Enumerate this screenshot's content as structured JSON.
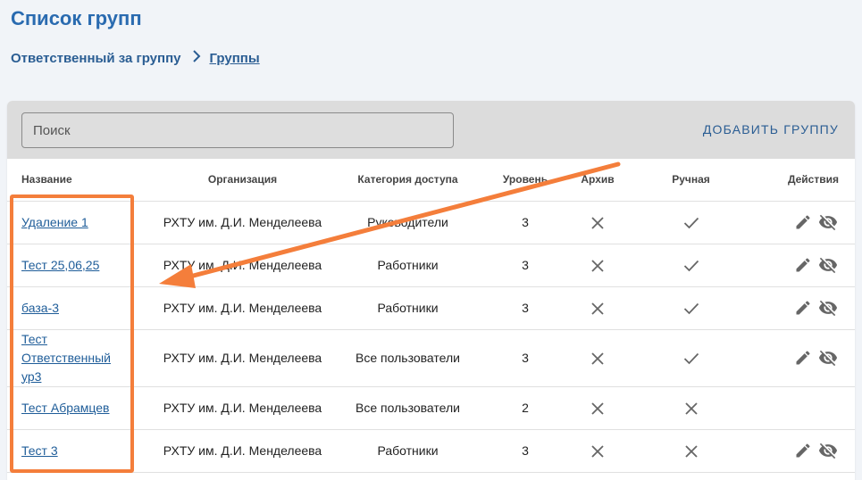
{
  "page": {
    "title": "Список групп"
  },
  "breadcrumb": {
    "parent": "Ответственный за группу",
    "separator": ">",
    "current": "Группы"
  },
  "toolbar": {
    "search_placeholder": "Поиск",
    "add_group_label": "ДОБАВИТЬ ГРУППУ"
  },
  "table": {
    "headers": {
      "name": "Название",
      "organization": "Организация",
      "access_category": "Категория доступа",
      "level": "Уровень",
      "archive": "Архив",
      "manual": "Ручная",
      "actions": "Действия"
    },
    "rows": [
      {
        "name": "Удаление 1",
        "organization": "РХТУ им. Д.И. Менделеева",
        "access_category": "Руководители",
        "level": "3",
        "archive": false,
        "manual": true,
        "has_actions": true
      },
      {
        "name": "Тест 25,06,25",
        "organization": "РХТУ им. Д.И. Менделеева",
        "access_category": "Работники",
        "level": "3",
        "archive": false,
        "manual": true,
        "has_actions": true
      },
      {
        "name": "база-3",
        "organization": "РХТУ им. Д.И. Менделеева",
        "access_category": "Работники",
        "level": "3",
        "archive": false,
        "manual": true,
        "has_actions": true
      },
      {
        "name": "Тест Ответственный ур3",
        "organization": "РХТУ им. Д.И. Менделеева",
        "access_category": "Все пользователи",
        "level": "3",
        "archive": false,
        "manual": true,
        "has_actions": true
      },
      {
        "name": "Тест Абрамцев",
        "organization": "РХТУ им. Д.И. Менделеева",
        "access_category": "Все пользователи",
        "level": "2",
        "archive": false,
        "manual": false,
        "has_actions": false
      },
      {
        "name": "Тест 3",
        "organization": "РХТУ им. Д.И. Менделеева",
        "access_category": "Работники",
        "level": "3",
        "archive": false,
        "manual": false,
        "has_actions": true
      }
    ]
  },
  "icons": {
    "archive_false": "close-icon",
    "manual_true": "check-icon",
    "manual_false": "close-icon",
    "edit": "pencil-icon",
    "hide": "eye-off-icon"
  },
  "colors": {
    "accent": "#2a6bb0",
    "link": "#1f5d99",
    "annotation": "#f47e3b"
  }
}
